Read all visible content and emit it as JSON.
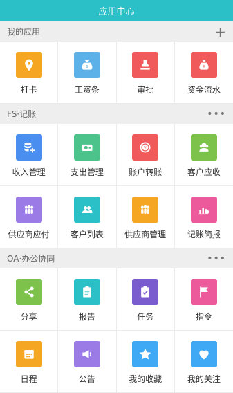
{
  "header": {
    "title": "应用中心"
  },
  "sections": [
    {
      "title": "我的应用",
      "action": "+",
      "items": [
        {
          "label": "打卡",
          "icon": "location-pin-icon",
          "color": "#f5a623"
        },
        {
          "label": "工资条",
          "icon": "money-bag-icon",
          "color": "#5cb1e8"
        },
        {
          "label": "审批",
          "icon": "stamp-icon",
          "color": "#f05a5a"
        },
        {
          "label": "资金流水",
          "icon": "money-sack-icon",
          "color": "#f05a5a"
        }
      ]
    },
    {
      "title": "FS·记账",
      "action": "•••",
      "items": [
        {
          "label": "收入管理",
          "icon": "coins-plus-icon",
          "color": "#4a8ff0"
        },
        {
          "label": "支出管理",
          "icon": "cash-icon",
          "color": "#4cc38a"
        },
        {
          "label": "账户转账",
          "icon": "transfer-icon",
          "color": "#f05a5a"
        },
        {
          "label": "客户应收",
          "icon": "customer-receivable-icon",
          "color": "#7cc24b"
        },
        {
          "label": "供应商应付",
          "icon": "supplier-payable-icon",
          "color": "#9b7be6"
        },
        {
          "label": "客户列表",
          "icon": "customer-list-icon",
          "color": "#2bbfc7"
        },
        {
          "label": "供应商管理",
          "icon": "supplier-icon",
          "color": "#f5a623"
        },
        {
          "label": "记账简报",
          "icon": "report-chart-icon",
          "color": "#ec5a9b"
        }
      ]
    },
    {
      "title": "OA·办公协同",
      "action": "•••",
      "items": [
        {
          "label": "分享",
          "icon": "share-icon",
          "color": "#7cc24b"
        },
        {
          "label": "报告",
          "icon": "document-icon",
          "color": "#2bbfc7"
        },
        {
          "label": "任务",
          "icon": "clipboard-check-icon",
          "color": "#7b5ccf"
        },
        {
          "label": "指令",
          "icon": "flag-icon",
          "color": "#ec5a9b"
        },
        {
          "label": "日程",
          "icon": "calendar-icon",
          "color": "#f5a623"
        },
        {
          "label": "公告",
          "icon": "megaphone-icon",
          "color": "#9b7be6"
        },
        {
          "label": "我的收藏",
          "icon": "star-icon",
          "color": "#3fa9f5"
        },
        {
          "label": "我的关注",
          "icon": "heart-icon",
          "color": "#3fa9f5"
        }
      ]
    }
  ]
}
